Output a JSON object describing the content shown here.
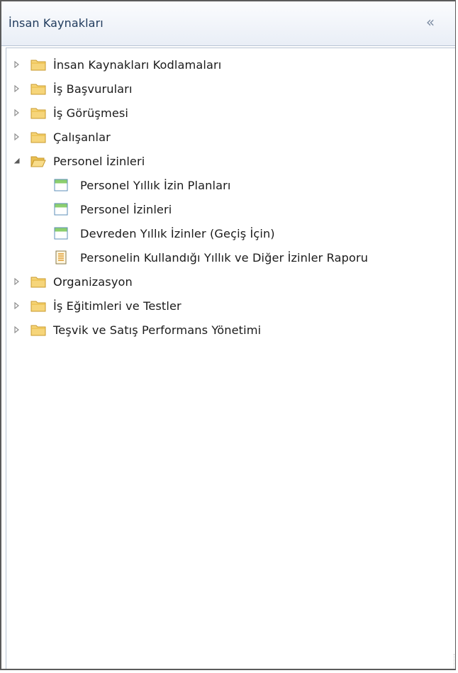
{
  "header": {
    "title": "İnsan Kaynakları",
    "collapse_glyph": "«"
  },
  "tree": {
    "items": [
      {
        "label": "İnsan Kaynakları Kodlamaları",
        "type": "folder",
        "expanded": false
      },
      {
        "label": "İş Başvuruları",
        "type": "folder",
        "expanded": false
      },
      {
        "label": "İş Görüşmesi",
        "type": "folder",
        "expanded": false
      },
      {
        "label": "Çalışanlar",
        "type": "folder",
        "expanded": false
      },
      {
        "label": "Personel İzinleri",
        "type": "folder",
        "expanded": true,
        "children": [
          {
            "label": "Personel Yıllık İzin Planları",
            "type": "form"
          },
          {
            "label": "Personel İzinleri",
            "type": "form"
          },
          {
            "label": "Devreden Yıllık İzinler (Geçiş İçin)",
            "type": "form"
          },
          {
            "label": "Personelin Kullandığı Yıllık ve Diğer İzinler Raporu",
            "type": "report"
          }
        ]
      },
      {
        "label": "Organizasyon",
        "type": "folder",
        "expanded": false
      },
      {
        "label": "İş Eğitimleri ve Testler",
        "type": "folder",
        "expanded": false
      },
      {
        "label": "Teşvik ve Satış Performans Yönetimi",
        "type": "folder",
        "expanded": false
      }
    ]
  },
  "colors": {
    "folder_fill": "#f6d57a",
    "folder_edge": "#c89a2c",
    "form_header": "#8ccf6e",
    "form_edge": "#5d8fb8",
    "report_edge": "#8a7a4a",
    "arrow": "#8f8f8f"
  }
}
